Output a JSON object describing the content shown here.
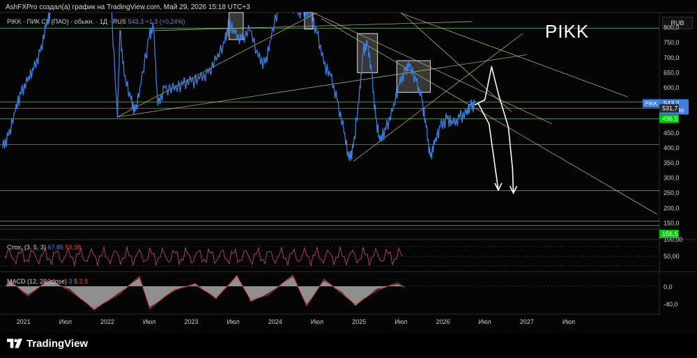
{
  "header": {
    "text": "AshFXPro создал(а) график на TradingView.com, Май 29, 2026 15:18 UTC+3"
  },
  "legend": {
    "symbol": "PIKK · ПИК СЗ (ПАО) · обыкн. · 1Д · RUS",
    "value": "543,3",
    "change": "+1,3 (+0,24%)"
  },
  "annotation": {
    "big_ticker": "PIKK"
  },
  "currency": "RUB",
  "price_tag": {
    "symbol": "PIKK",
    "price": "543,3",
    "countdown": "08:31:46"
  },
  "level_tags": [
    {
      "value": "531,7",
      "color": "#2a2a2a"
    },
    {
      "value": "496,5",
      "color": "#00c800"
    },
    {
      "value": "156,5",
      "color": "#00c800"
    }
  ],
  "indicators": {
    "stoch": {
      "label": "Стох. (3, 5, 3)",
      "v1": "67,85",
      "v2": "59,38",
      "ticks": [
        "100,00",
        "50,00"
      ]
    },
    "macd": {
      "label": "MACD (12, 26, close)",
      "v1": "3",
      "v2": "5",
      "v3": "2,8",
      "ticks": [
        "0,0",
        "-40,0"
      ]
    }
  },
  "brand": {
    "name": "TradingView"
  },
  "colors": {
    "price_line": "#3d7fe0",
    "level_line": "#7fd37f",
    "trend_line": "#c9c97a",
    "stoch_line": "#c0407a",
    "macd_fill": "#bdbdbd",
    "macd_line": "#e03a3a"
  },
  "chart_data": {
    "type": "line",
    "title": "PIKK",
    "x_labels": [
      "Июл",
      "2021",
      "Июл",
      "2022",
      "Июл",
      "2023",
      "Июл",
      "2024",
      "Июл",
      "2025",
      "Июл",
      "2026",
      "Июл",
      "2027",
      "Июл"
    ],
    "y_ticks": [
      800,
      750,
      700,
      650,
      600,
      550,
      450,
      400,
      350,
      300,
      250,
      200,
      150
    ],
    "y_tick_labels": [
      "800,0",
      "750,0",
      "700,0",
      "650,0",
      "600,0",
      "550,0",
      "450,0",
      "400,0",
      "350,0",
      "300,0",
      "250,0",
      "200,0",
      "150,0"
    ],
    "ylim": [
      130,
      850
    ],
    "series": [
      {
        "values": [
          {
            "x": 2020.75,
            "y": 400
          },
          {
            "x": 2020.82,
            "y": 440
          },
          {
            "x": 2020.9,
            "y": 520
          },
          {
            "x": 2020.97,
            "y": 580
          },
          {
            "x": 2021.05,
            "y": 620
          },
          {
            "x": 2021.12,
            "y": 660
          },
          {
            "x": 2021.2,
            "y": 720
          },
          {
            "x": 2021.27,
            "y": 800
          },
          {
            "x": 2021.33,
            "y": 860
          },
          {
            "x": 2021.45,
            "y": 950
          },
          {
            "x": 2021.6,
            "y": 1050
          },
          {
            "x": 2021.75,
            "y": 1150
          },
          {
            "x": 2021.85,
            "y": 1250
          },
          {
            "x": 2021.95,
            "y": 1100
          },
          {
            "x": 2022.04,
            "y": 900
          },
          {
            "x": 2022.12,
            "y": 500
          },
          {
            "x": 2022.15,
            "y": 790
          },
          {
            "x": 2022.2,
            "y": 640
          },
          {
            "x": 2022.28,
            "y": 560
          },
          {
            "x": 2022.33,
            "y": 520
          },
          {
            "x": 2022.4,
            "y": 610
          },
          {
            "x": 2022.5,
            "y": 770
          },
          {
            "x": 2022.55,
            "y": 800
          },
          {
            "x": 2022.6,
            "y": 540
          },
          {
            "x": 2022.68,
            "y": 600
          },
          {
            "x": 2022.8,
            "y": 590
          },
          {
            "x": 2022.9,
            "y": 610
          },
          {
            "x": 2023.0,
            "y": 620
          },
          {
            "x": 2023.1,
            "y": 630
          },
          {
            "x": 2023.2,
            "y": 650
          },
          {
            "x": 2023.3,
            "y": 690
          },
          {
            "x": 2023.4,
            "y": 750
          },
          {
            "x": 2023.45,
            "y": 820
          },
          {
            "x": 2023.52,
            "y": 780
          },
          {
            "x": 2023.6,
            "y": 760
          },
          {
            "x": 2023.7,
            "y": 790
          },
          {
            "x": 2023.8,
            "y": 700
          },
          {
            "x": 2023.88,
            "y": 680
          },
          {
            "x": 2023.95,
            "y": 760
          },
          {
            "x": 2024.05,
            "y": 880
          },
          {
            "x": 2024.15,
            "y": 870
          },
          {
            "x": 2024.25,
            "y": 860
          },
          {
            "x": 2024.32,
            "y": 850
          },
          {
            "x": 2024.42,
            "y": 840
          },
          {
            "x": 2024.5,
            "y": 780
          },
          {
            "x": 2024.58,
            "y": 680
          },
          {
            "x": 2024.66,
            "y": 640
          },
          {
            "x": 2024.74,
            "y": 560
          },
          {
            "x": 2024.82,
            "y": 450
          },
          {
            "x": 2024.88,
            "y": 360
          },
          {
            "x": 2024.93,
            "y": 400
          },
          {
            "x": 2025.0,
            "y": 560
          },
          {
            "x": 2025.05,
            "y": 720
          },
          {
            "x": 2025.1,
            "y": 740
          },
          {
            "x": 2025.15,
            "y": 650
          },
          {
            "x": 2025.2,
            "y": 500
          },
          {
            "x": 2025.25,
            "y": 420
          },
          {
            "x": 2025.32,
            "y": 460
          },
          {
            "x": 2025.4,
            "y": 520
          },
          {
            "x": 2025.48,
            "y": 610
          },
          {
            "x": 2025.55,
            "y": 660
          },
          {
            "x": 2025.6,
            "y": 670
          },
          {
            "x": 2025.68,
            "y": 620
          },
          {
            "x": 2025.75,
            "y": 560
          },
          {
            "x": 2025.8,
            "y": 470
          },
          {
            "x": 2025.85,
            "y": 370
          },
          {
            "x": 2025.9,
            "y": 410
          },
          {
            "x": 2025.97,
            "y": 470
          },
          {
            "x": 2026.05,
            "y": 500
          },
          {
            "x": 2026.12,
            "y": 480
          },
          {
            "x": 2026.2,
            "y": 500
          },
          {
            "x": 2026.28,
            "y": 510
          },
          {
            "x": 2026.33,
            "y": 540
          },
          {
            "x": 2026.38,
            "y": 543.3
          }
        ]
      }
    ],
    "levels": [
      798,
      553,
      531.7,
      496.5,
      411,
      258,
      156.5,
      142
    ],
    "highlight_boxes": [
      {
        "x0": 2023.45,
        "x1": 2023.62,
        "y0": 760,
        "y1": 850
      },
      {
        "x0": 2024.35,
        "x1": 2024.45,
        "y0": 795,
        "y1": 850
      },
      {
        "x0": 2024.98,
        "x1": 2025.22,
        "y0": 650,
        "y1": 780
      },
      {
        "x0": 2025.45,
        "x1": 2025.85,
        "y0": 585,
        "y1": 690
      }
    ],
    "forecast_arrows": [
      {
        "points": [
          {
            "x": 2026.38,
            "y": 543
          },
          {
            "x": 2026.5,
            "y": 560
          },
          {
            "x": 2026.58,
            "y": 670
          },
          {
            "x": 2026.67,
            "y": 570
          },
          {
            "x": 2026.78,
            "y": 470
          },
          {
            "x": 2026.83,
            "y": 330
          },
          {
            "x": 2026.84,
            "y": 250
          }
        ]
      },
      {
        "points": [
          {
            "x": 2026.42,
            "y": 548
          },
          {
            "x": 2026.55,
            "y": 480
          },
          {
            "x": 2026.65,
            "y": 280
          },
          {
            "x": 2026.66,
            "y": 260
          }
        ]
      }
    ],
    "trend_lines": [
      {
        "x0": 2022.12,
        "y0": 503,
        "x1": 2027.0,
        "y1": 710
      },
      {
        "x0": 2022.12,
        "y0": 503,
        "x1": 2024.5,
        "y1": 850
      },
      {
        "x0": 2024.93,
        "y0": 355,
        "x1": 2026.95,
        "y1": 780
      },
      {
        "x0": 2022.55,
        "y0": 790,
        "x1": 2026.35,
        "y1": 820
      },
      {
        "x0": 2024.45,
        "y0": 850,
        "x1": 2027.3,
        "y1": 480
      },
      {
        "x0": 2024.55,
        "y0": 830,
        "x1": 2028.55,
        "y1": 180
      },
      {
        "x0": 2025.5,
        "y0": 850,
        "x1": 2026.82,
        "y1": 520
      },
      {
        "x0": 2025.5,
        "y0": 848,
        "x1": 2028.2,
        "y1": 570
      }
    ]
  }
}
